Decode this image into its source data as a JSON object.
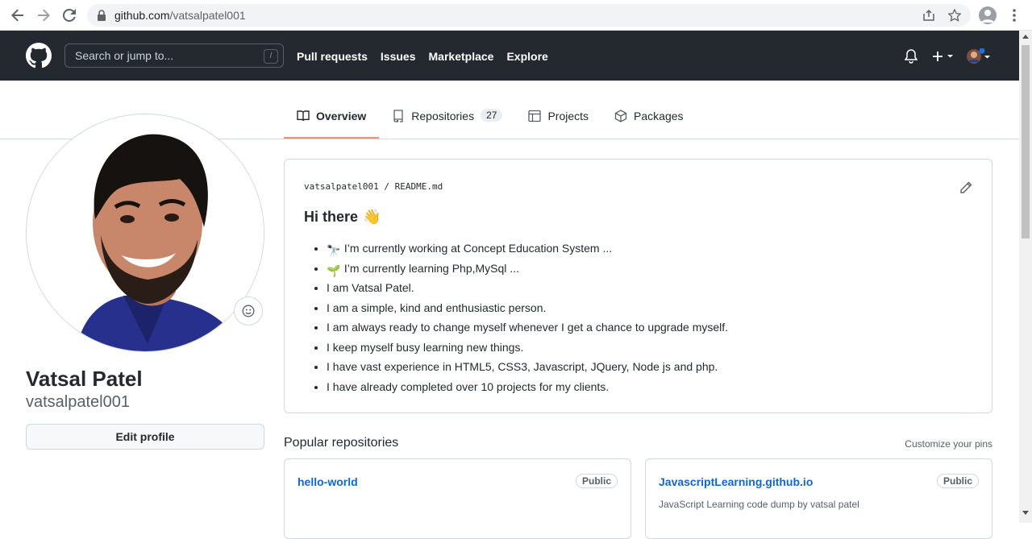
{
  "browser": {
    "url_host": "github.com",
    "url_path": "/vatsalpatel001"
  },
  "header": {
    "search_placeholder": "Search or jump to...",
    "search_shortcut": "/",
    "nav": [
      "Pull requests",
      "Issues",
      "Marketplace",
      "Explore"
    ]
  },
  "tabs": [
    {
      "label": "Overview",
      "icon": "book-icon"
    },
    {
      "label": "Repositories",
      "icon": "repo-icon",
      "count": "27"
    },
    {
      "label": "Projects",
      "icon": "project-icon"
    },
    {
      "label": "Packages",
      "icon": "package-icon"
    }
  ],
  "profile": {
    "fullname": "Vatsal Patel",
    "username": "vatsalpatel001",
    "edit_label": "Edit profile"
  },
  "readme": {
    "owner": "vatsalpatel001",
    "sep": "/",
    "file": "README.md",
    "heading": "Hi there",
    "heading_emoji": "👋",
    "items": [
      {
        "emoji": "🔭",
        "text": "I’m currently working at Concept Education System ..."
      },
      {
        "emoji": "🌱",
        "text": "I’m currently learning Php,MySql ..."
      },
      {
        "emoji": "",
        "text": "I am Vatsal Patel."
      },
      {
        "emoji": "",
        "text": "I am a simple, kind and enthusiastic person."
      },
      {
        "emoji": "",
        "text": "I am always ready to change myself whenever I get a chance to upgrade myself."
      },
      {
        "emoji": "",
        "text": "I keep myself busy learning new things."
      },
      {
        "emoji": "",
        "text": "I have vast experience in HTML5, CSS3, Javascript, JQuery, Node js and php."
      },
      {
        "emoji": "",
        "text": "I have already completed over 10 projects for my clients."
      }
    ]
  },
  "popular": {
    "title": "Popular repositories",
    "customize": "Customize your pins",
    "repos": [
      {
        "name": "hello-world",
        "visibility": "Public",
        "description": ""
      },
      {
        "name": "JavascriptLearning.github.io",
        "visibility": "Public",
        "description": "JavaScript Learning code dump by vatsal patel"
      }
    ]
  },
  "colors": {
    "header_bg": "#24292f",
    "tab_underline": "#fd8c73",
    "link": "#0969da"
  }
}
